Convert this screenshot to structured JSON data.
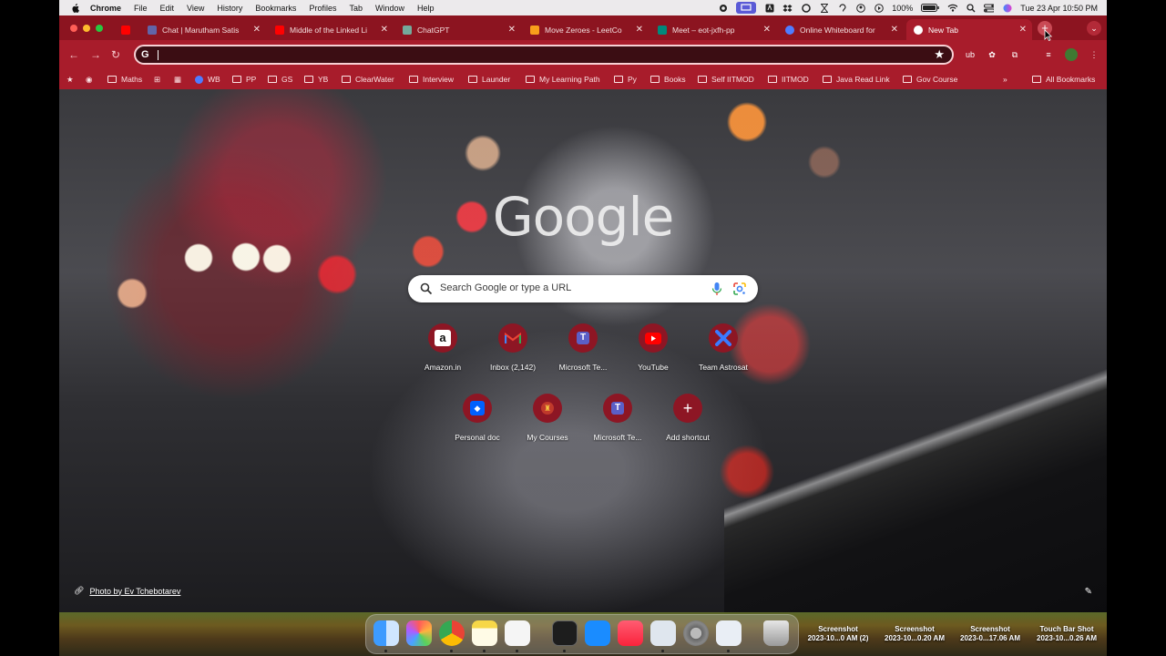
{
  "menubar": {
    "app": "Chrome",
    "items": [
      "File",
      "Edit",
      "View",
      "History",
      "Bookmarks",
      "Profiles",
      "Tab",
      "Window",
      "Help"
    ],
    "battery": "100%",
    "datetime": "Tue 23 Apr  10:50 PM"
  },
  "tabs": [
    {
      "title": "",
      "icon": "youtube-icon",
      "color": "#ff0000"
    },
    {
      "title": "Chat | Marutham Satis",
      "icon": "teams-icon",
      "color": "#6264a7"
    },
    {
      "title": "Middle of the Linked Li",
      "icon": "youtube-icon",
      "color": "#ff0000"
    },
    {
      "title": "ChatGPT",
      "icon": "chatgpt-icon",
      "color": "#74aa9c"
    },
    {
      "title": "Move Zeroes - LeetCo",
      "icon": "leetcode-icon",
      "color": "#f89f1b"
    },
    {
      "title": "Meet – eot-jxfh-pp",
      "icon": "meet-icon",
      "color": "#00897b"
    },
    {
      "title": "Online Whiteboard for",
      "icon": "whiteboard-icon",
      "color": "#4f7cff"
    },
    {
      "title": "New Tab",
      "icon": "chrome-icon",
      "color": "#ffffff"
    }
  ],
  "omnibox": {
    "value": ""
  },
  "bookmarks": [
    {
      "label": "",
      "type": "star"
    },
    {
      "label": "",
      "type": "globe"
    },
    {
      "label": "Maths",
      "type": "folder"
    },
    {
      "label": "",
      "type": "site"
    },
    {
      "label": "",
      "type": "site"
    },
    {
      "label": "WB",
      "type": "site"
    },
    {
      "label": "PP",
      "type": "folder"
    },
    {
      "label": "GS",
      "type": "folder"
    },
    {
      "label": "YB",
      "type": "folder"
    },
    {
      "label": "ClearWater",
      "type": "folder"
    },
    {
      "label": "Interview",
      "type": "folder"
    },
    {
      "label": "Launder",
      "type": "folder"
    },
    {
      "label": "My Learning Path",
      "type": "folder"
    },
    {
      "label": "Py",
      "type": "folder"
    },
    {
      "label": "Books",
      "type": "folder"
    },
    {
      "label": "Self IITMOD",
      "type": "folder"
    },
    {
      "label": "IITMOD",
      "type": "folder"
    },
    {
      "label": "Java Read Link",
      "type": "folder"
    },
    {
      "label": "Gov Course",
      "type": "folder"
    }
  ],
  "all_bookmarks": "All Bookmarks",
  "google_logo": "Google",
  "search": {
    "placeholder": "Search Google or type a URL"
  },
  "shortcuts": [
    {
      "label": "Amazon.in",
      "icon": "amazon-icon"
    },
    {
      "label": "Inbox (2,142)",
      "icon": "gmail-icon"
    },
    {
      "label": "Microsoft Te...",
      "icon": "teams-icon"
    },
    {
      "label": "YouTube",
      "icon": "youtube-icon"
    },
    {
      "label": "Team Astrosat",
      "icon": "astrosat-icon"
    },
    {
      "label": "Personal doc",
      "icon": "dropbox-icon"
    },
    {
      "label": "My Courses",
      "icon": "courses-icon"
    },
    {
      "label": "Microsoft Te...",
      "icon": "teams-icon"
    },
    {
      "label": "Add shortcut",
      "icon": "plus-icon"
    }
  ],
  "photo_credit": "Photo by Ev Tchebotarev",
  "dock": [
    "finder",
    "launchpad",
    "chrome",
    "notes",
    "textedit",
    "terminal",
    "appstore",
    "music",
    "preview",
    "systemsettings",
    "screenshot-app",
    "trash"
  ],
  "desktop_files": [
    {
      "line1": "Screenshot",
      "line2": "2023-10...0 AM (2)"
    },
    {
      "line1": "Screenshot",
      "line2": "2023-10...0.20 AM"
    },
    {
      "line1": "Screenshot",
      "line2": "2023-0...17.06 AM"
    },
    {
      "line1": "Touch Bar Shot",
      "line2": "2023-10...0.26 AM"
    }
  ]
}
